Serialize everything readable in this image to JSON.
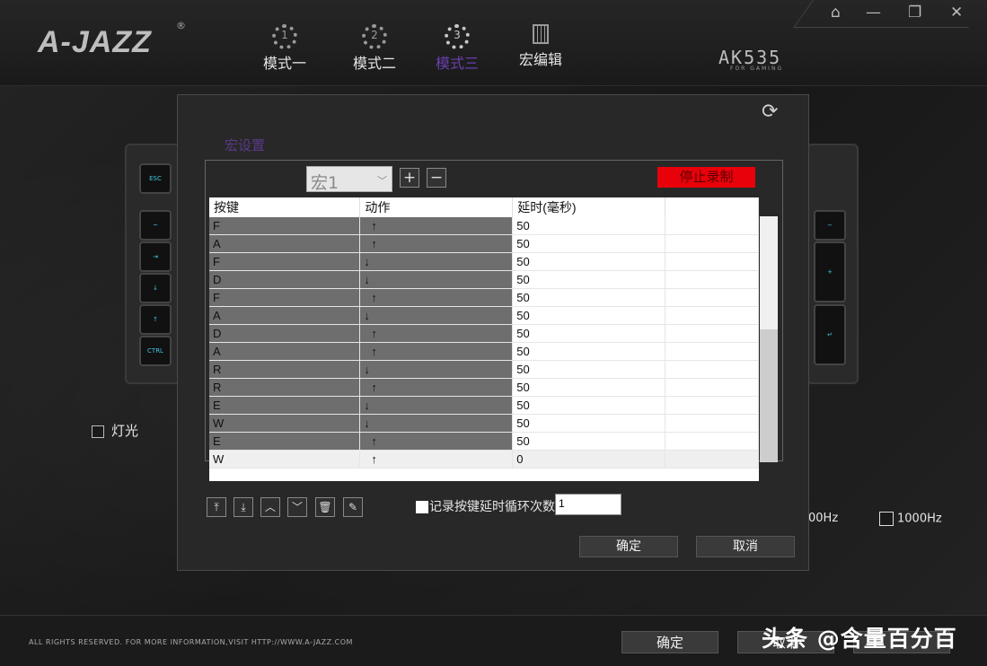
{
  "header": {
    "logo": "A-JAZZ",
    "logo_reg": "®",
    "modes": [
      "模式一",
      "模式二",
      "模式三"
    ],
    "mode_numbers": [
      "1",
      "2",
      "3"
    ],
    "active_mode": 2,
    "macro_editor": "宏编辑",
    "model": "AK535",
    "model_sub": "FOR GAMING"
  },
  "window_controls": {
    "home": "⌂",
    "minimize": "—",
    "restore": "❐",
    "close": "✕"
  },
  "keyboard": {
    "left_keys": [
      "ESC",
      "~",
      "⇥",
      "↓",
      "↑",
      "CTRL"
    ],
    "right_keys": [
      "−",
      "+",
      "↵"
    ]
  },
  "light": {
    "label": "灯光",
    "checked": false
  },
  "polling": {
    "hz_partial": "00Hz",
    "hz_1000": "1000Hz"
  },
  "dialog": {
    "title": "宏设置",
    "macro_name": "宏1",
    "add_label": "+",
    "remove_label": "−",
    "stop_recording": "停止录制",
    "columns": [
      "按键",
      "动作",
      "延时(毫秒)"
    ],
    "rows": [
      {
        "key": "F",
        "action": "↑",
        "delay": "50"
      },
      {
        "key": "A",
        "action": "↑",
        "delay": "50"
      },
      {
        "key": "F",
        "action": "↓",
        "delay": "50"
      },
      {
        "key": "D",
        "action": "↓",
        "delay": "50"
      },
      {
        "key": "F",
        "action": "↑",
        "delay": "50"
      },
      {
        "key": "A",
        "action": "↓",
        "delay": "50"
      },
      {
        "key": "D",
        "action": "↑",
        "delay": "50"
      },
      {
        "key": "A",
        "action": "↑",
        "delay": "50"
      },
      {
        "key": "R",
        "action": "↓",
        "delay": "50"
      },
      {
        "key": "R",
        "action": "↑",
        "delay": "50"
      },
      {
        "key": "E",
        "action": "↓",
        "delay": "50"
      },
      {
        "key": "W",
        "action": "↓",
        "delay": "50"
      },
      {
        "key": "E",
        "action": "↑",
        "delay": "50"
      },
      {
        "key": "W",
        "action": "↑",
        "delay": "0"
      }
    ],
    "toolbar_icons": [
      "move-top-icon",
      "move-bottom-icon",
      "move-up-icon",
      "move-down-icon",
      "delete-icon",
      "clear-icon"
    ],
    "loop_label": "记录按键延时循环次数",
    "loop_count": "1",
    "ok": "确定",
    "cancel": "取消"
  },
  "footer": {
    "copyright": "ALL RIGHTS RESERVED. FOR MORE INFORMATION,VISIT HTTP://WWW.A-JAZZ.COM",
    "ok": "确定",
    "cancel": "取消",
    "watermark": "头条 @含量百分百"
  }
}
